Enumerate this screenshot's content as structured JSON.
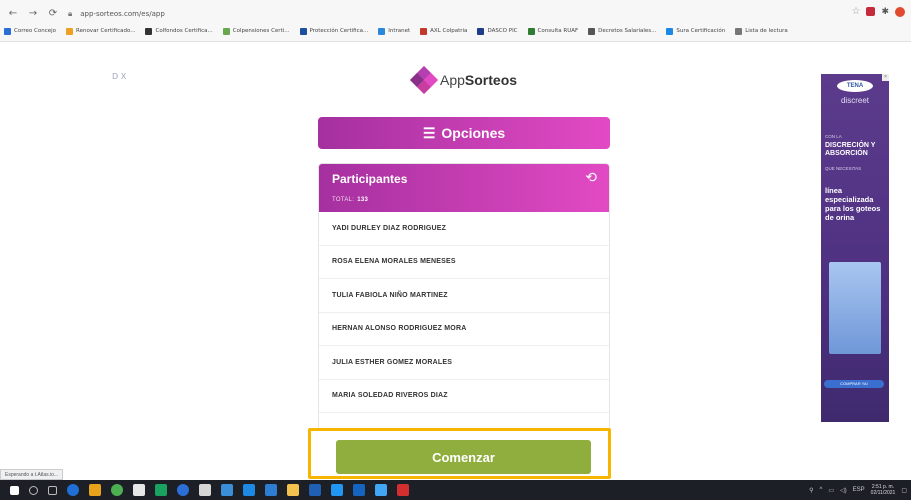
{
  "browser": {
    "url": "app-sorteos.com/es/app",
    "bookmarks": [
      "Correo Concejo",
      "Renovar Certificado...",
      "Colfondos Certifica...",
      "Colpensiones Certi...",
      "Protección Certifica...",
      "Intranet",
      "AXL Colpatria",
      "DASCO PIC",
      "Consulta RUAF",
      "Decretos Salariales...",
      "Sura Certificación",
      "Lista de lectura"
    ]
  },
  "ad_left": {
    "label": "D X"
  },
  "logo": {
    "prefix": "App",
    "bold": "Sorteos"
  },
  "options": {
    "label": "Opciones"
  },
  "participants": {
    "title": "Participantes",
    "total_label": "TOTAL:",
    "total_value": "133",
    "names": [
      "YADI DURLEY DIAZ RODRIGUEZ",
      "ROSA ELENA MORALES MENESES",
      "TULIA FABIOLA NIÑO MARTINEZ",
      "HERNAN ALONSO RODRIGUEZ MORA",
      "JULIA ESTHER GOMEZ MORALES",
      "MARIA SOLEDAD RIVEROS DIAZ"
    ]
  },
  "start_button": {
    "label": "Comenzar"
  },
  "status_bar": {
    "text": "Esperando a t.Atlas.io..."
  },
  "ad_right": {
    "brand": "TENA",
    "sub": "discreet",
    "small1": "CON LA",
    "headline": "DISCRECIÓN Y ABSORCIÓN",
    "small2": "QUE NECESITAS",
    "line": "línea especializada para los goteos de orina",
    "cta": "COMPRAR YA!"
  },
  "taskbar": {
    "time": "2:51 p. m.",
    "date": "02/11/2021",
    "lang": "ESP"
  },
  "colors": {
    "accent_start": "#a5309f",
    "accent_end": "#e24ac4",
    "start_button": "#8fae3e",
    "highlight": "#f7b500"
  }
}
